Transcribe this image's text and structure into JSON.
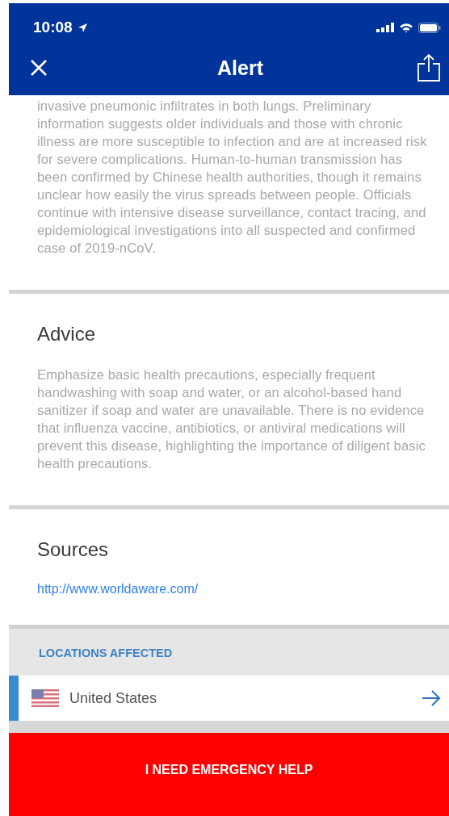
{
  "status_bar": {
    "time": "10:08"
  },
  "nav": {
    "title": "Alert"
  },
  "summary": {
    "text": "invasive pneumonic infiltrates in both lungs. Preliminary information suggests older individuals and those with chronic illness are more susceptible to infection and are at increased risk for severe complications. Human-to-human transmission has been confirmed by Chinese health authorities, though it remains unclear how easily the virus spreads between people. Officials continue with intensive disease surveillance, contact tracing, and epidemiological investigations into all suspected and confirmed case of 2019-nCoV."
  },
  "advice": {
    "heading": "Advice",
    "text": "Emphasize basic health precautions, especially frequent handwashing with soap and water, or an alcohol-based hand sanitizer if soap and water are unavailable. There is no evidence that influenza vaccine, antibiotics, or antiviral medications will prevent this disease, highlighting the importance of diligent basic health precautions."
  },
  "sources": {
    "heading": "Sources",
    "links": [
      "http://www.worldaware.com/"
    ]
  },
  "locations": {
    "heading": "LOCATIONS AFFECTED",
    "items": [
      {
        "name": "United States"
      }
    ]
  },
  "emergency_button": {
    "label": "I NEED EMERGENCY HELP"
  }
}
